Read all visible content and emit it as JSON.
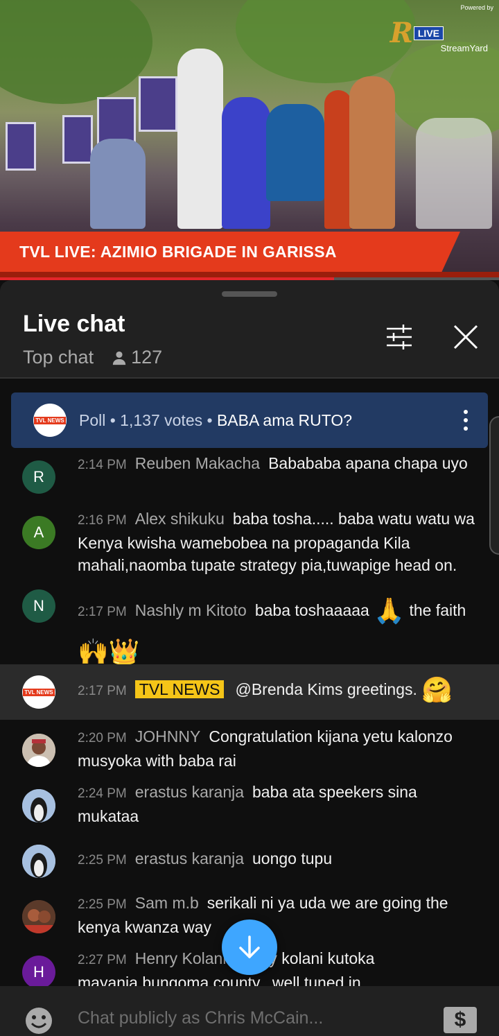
{
  "video": {
    "banner": "TVL LIVE: AZIMIO BRIGADE IN GARISSA",
    "brand_powered": "Powered by",
    "brand_live": "LIVE",
    "brand_streamyard": "StreamYard",
    "progress": 0.67
  },
  "chat": {
    "title": "Live chat",
    "mode": "Top chat",
    "viewer_count": "127",
    "poll": {
      "label": "Poll • 1,137 votes • ",
      "question": "BABA ama RUTO?"
    },
    "messages": [
      {
        "time": "2:14 PM",
        "author": "Reuben Makacha",
        "text": "Babababa apana chapa uyo",
        "avatar_letter": "R",
        "avatar_color": "#1f5b45"
      },
      {
        "time": "2:16 PM",
        "author": "Alex shikuku",
        "text": "baba tosha..... baba watu watu wa Kenya kwisha wamebobea na propaganda Kila mahali,naomba tupate strategy pia,tuwapige head on.",
        "avatar_letter": "A",
        "avatar_color": "#3b7a24"
      },
      {
        "time": "2:17 PM",
        "author": "Nashly m Kitoto",
        "text_a": "baba toshaaaaa",
        "text_b": "the faith",
        "emoji_1": "🙏",
        "emoji_2": "🙌👑",
        "avatar_letter": "N",
        "avatar_color": "#1f5b45"
      },
      {
        "time": "2:17 PM",
        "author": "TVL NEWS",
        "text": "@Brenda Kims greetings.",
        "emoji": "🤗",
        "avatar_text": "TVL NEWS"
      },
      {
        "time": "2:20 PM",
        "author": "JOHNNY",
        "text": "Congratulation kijana yetu kalonzo musyoka with baba rai"
      },
      {
        "time": "2:24 PM",
        "author": "erastus karanja",
        "text": "baba ata speekers sina mukataa"
      },
      {
        "time": "2:25 PM",
        "author": "erastus karanja",
        "text": "uongo tupu"
      },
      {
        "time": "2:25 PM",
        "author": "Sam m.b",
        "text": "serikali ni ya uda we are going the kenya kwanza way"
      },
      {
        "time": "2:27 PM",
        "author": "Henry Kolani",
        "text": "Henry kolani kutoka mayania,bungoma county...well tuned in",
        "avatar_letter": "H",
        "avatar_color": "#6a1b9a"
      }
    ],
    "input_placeholder": "Chat publicly as Chris McCain..."
  }
}
